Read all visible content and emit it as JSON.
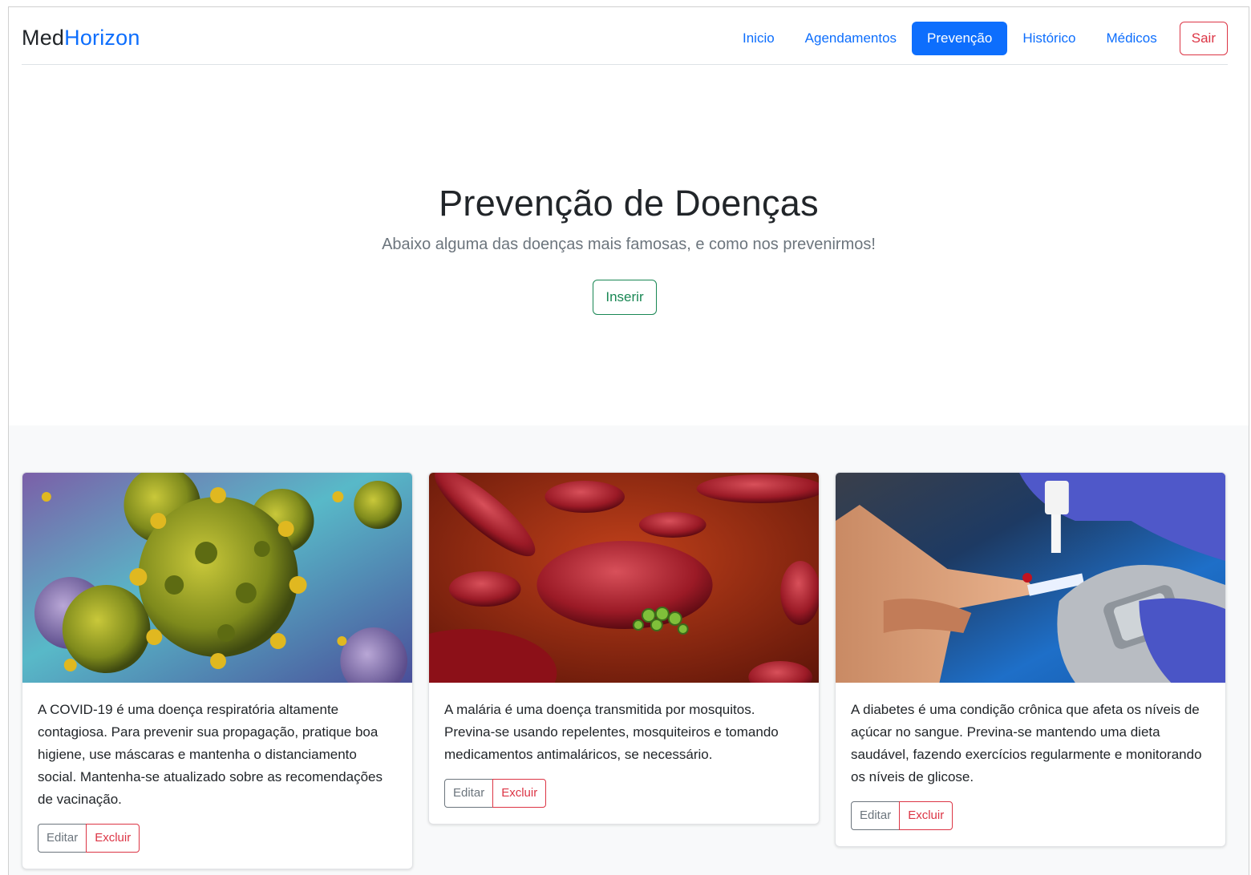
{
  "header": {
    "brand_prefix": "Med",
    "brand_accent": "Horizon",
    "nav": [
      {
        "label": "Inicio",
        "active": false
      },
      {
        "label": "Agendamentos",
        "active": false
      },
      {
        "label": "Prevenção",
        "active": true
      },
      {
        "label": "Histórico",
        "active": false
      },
      {
        "label": "Médicos",
        "active": false
      }
    ],
    "logout_label": "Sair"
  },
  "hero": {
    "title": "Prevenção de Doenças",
    "subtitle": "Abaixo alguma das doenças mais famosas, e como nos prevenirmos!",
    "insert_label": "Inserir"
  },
  "cards": [
    {
      "image": "coronavirus-image",
      "text": "A COVID-19 é uma doença respiratória altamente contagiosa. Para prevenir sua propagação, pratique boa higiene, use máscaras e mantenha o distanciamento social. Mantenha-se atualizado sobre as recomendações de vacinação.",
      "edit_label": "Editar",
      "delete_label": "Excluir"
    },
    {
      "image": "malaria-blood-cells-image",
      "text": "A malária é uma doença transmitida por mosquitos. Previna-se usando repelentes, mosquiteiros e tomando medicamentos antimaláricos, se necessário.",
      "edit_label": "Editar",
      "delete_label": "Excluir"
    },
    {
      "image": "glucose-test-image",
      "text": "A diabetes é uma condição crônica que afeta os níveis de açúcar no sangue. Previna-se mantendo uma dieta saudável, fazendo exercícios regularmente e monitorando os níveis de glicose.",
      "edit_label": "Editar",
      "delete_label": "Excluir"
    }
  ],
  "colors": {
    "primary": "#0d6efd",
    "danger": "#dc3545",
    "success": "#198754",
    "secondary": "#6c757d"
  }
}
